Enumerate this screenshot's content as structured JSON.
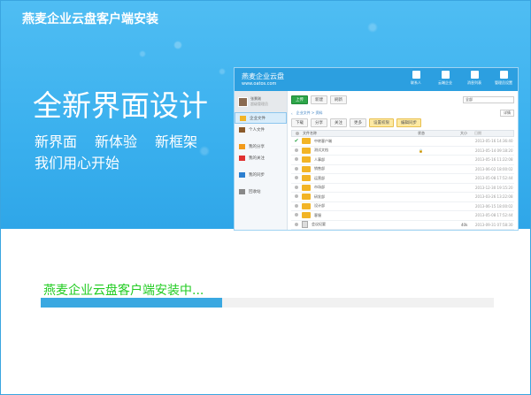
{
  "window": {
    "title": "燕麦企业云盘客户端安装"
  },
  "banner": {
    "headline": "全新界面设计",
    "features": [
      "新界面",
      "新体验",
      "新框架"
    ],
    "tagline": "我们用心开始"
  },
  "mockup": {
    "logo": {
      "name": "燕麦企业云盘",
      "url": "www.oatos.com"
    },
    "header_icons": [
      {
        "label": "联系人",
        "icon": "contacts-icon"
      },
      {
        "label": "云端企业",
        "icon": "enterprise-icon"
      },
      {
        "label": "消息列表",
        "icon": "message-icon"
      },
      {
        "label": "管理员设置",
        "icon": "gear-icon"
      }
    ],
    "user": {
      "name": "张景刚",
      "subtitle": "超级管理员"
    },
    "sidebar": [
      {
        "label": "企业文件",
        "active": true,
        "color": "#f2b426"
      },
      {
        "label": "个人文件",
        "color": "#8a5a2a"
      },
      {
        "label": "我的分享",
        "color": "#f29a1a"
      },
      {
        "label": "我的关注",
        "color": "#e03030"
      },
      {
        "label": "我的同步",
        "color": "#2c7fd0"
      },
      {
        "label": "回收站",
        "color": "#888888"
      }
    ],
    "toolbar": {
      "upload": "上传",
      "new": "新建",
      "refresh": "刷新",
      "search_placeholder": "全部"
    },
    "breadcrumb": "企业文件 > 资料",
    "view": "详情",
    "actions": [
      "下载",
      "分享",
      "关注",
      "更多",
      "设置权限",
      "编辑同步"
    ],
    "columns": [
      "文件名称",
      "状态",
      "大小",
      "日期"
    ],
    "rows": [
      {
        "name": "中转客户端",
        "date": "2013-05-16 14:36:40",
        "type": "folder",
        "checked": true
      },
      {
        "name": "测试文档",
        "date": "2013-05-14 09:18:20",
        "type": "folder",
        "status": "🔒"
      },
      {
        "name": "人事部",
        "date": "2013-05-16 11:22:08",
        "type": "folder"
      },
      {
        "name": "销售部",
        "date": "2013-06-02 18:00:02",
        "type": "folder"
      },
      {
        "name": "运营部",
        "date": "2013-05-08 17:52:44",
        "type": "folder"
      },
      {
        "name": "市场部",
        "date": "2013-12-30 19:15:20",
        "type": "folder"
      },
      {
        "name": "研发部",
        "date": "2013-03-26 13:22:08",
        "type": "folder"
      },
      {
        "name": "设计部",
        "date": "2013-06-15 18:00:02",
        "type": "folder"
      },
      {
        "name": "客服",
        "date": "2013-05-08 17:52:44",
        "type": "folder"
      },
      {
        "name": "会议纪要",
        "date": "2013-09-31 07:58:30",
        "type": "file",
        "size": "40k"
      }
    ]
  },
  "install": {
    "status": "燕麦企业云盘客户端安装中...",
    "progress_percent": 40,
    "accent": "#3aa8e1",
    "status_color": "#22cc22"
  }
}
